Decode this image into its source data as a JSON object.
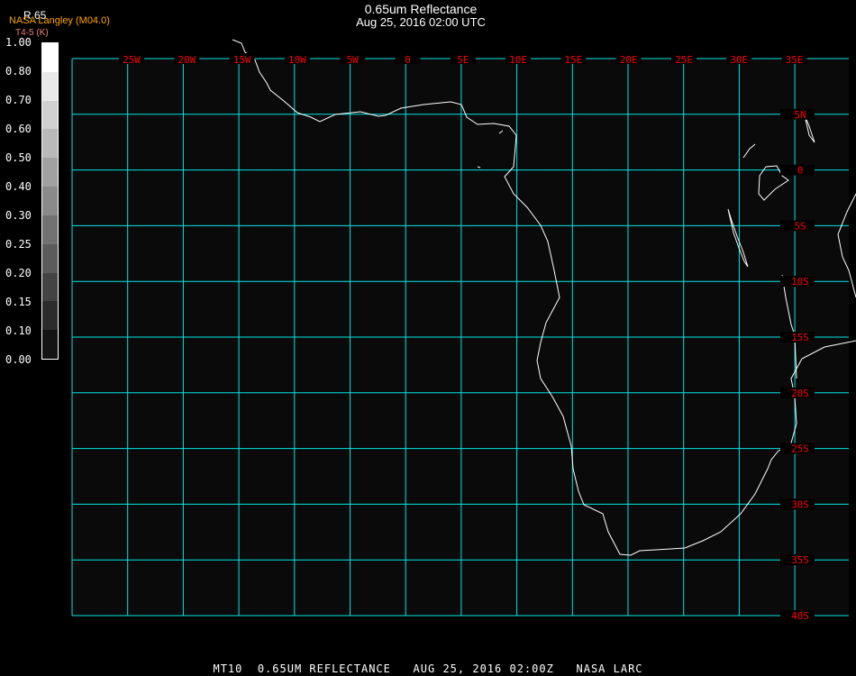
{
  "header": {
    "title": "0.65um Reflectance",
    "subtitle": "Aug 25, 2016 02:00 UTC",
    "agency": "NASA Langley (M04.0)",
    "product_code": "R 65",
    "secondary_label": "T4-5 (K)"
  },
  "colorbar": {
    "labels": [
      "1.00",
      "0.80",
      "0.70",
      "0.60",
      "0.50",
      "0.40",
      "0.30",
      "0.25",
      "0.20",
      "0.15",
      "0.10",
      "0.00"
    ]
  },
  "map": {
    "lon_labels": [
      "25W",
      "20W",
      "15W",
      "10W",
      "5W",
      "0",
      "5E",
      "10E",
      "15E",
      "20E",
      "25E",
      "30E",
      "35E"
    ],
    "lat_labels": [
      "5N",
      "0",
      "5S",
      "10S",
      "15S",
      "20S",
      "25S",
      "30S",
      "35S",
      "40S"
    ],
    "colors": {
      "grid": "#00e5e5",
      "label": "#ff0000",
      "coast": "#ffffff",
      "background": "#0a0a0a"
    }
  },
  "footer": {
    "caption": "MT10  0.65UM REFLECTANCE   AUG 25, 2016 02:00Z   NASA LARC"
  }
}
